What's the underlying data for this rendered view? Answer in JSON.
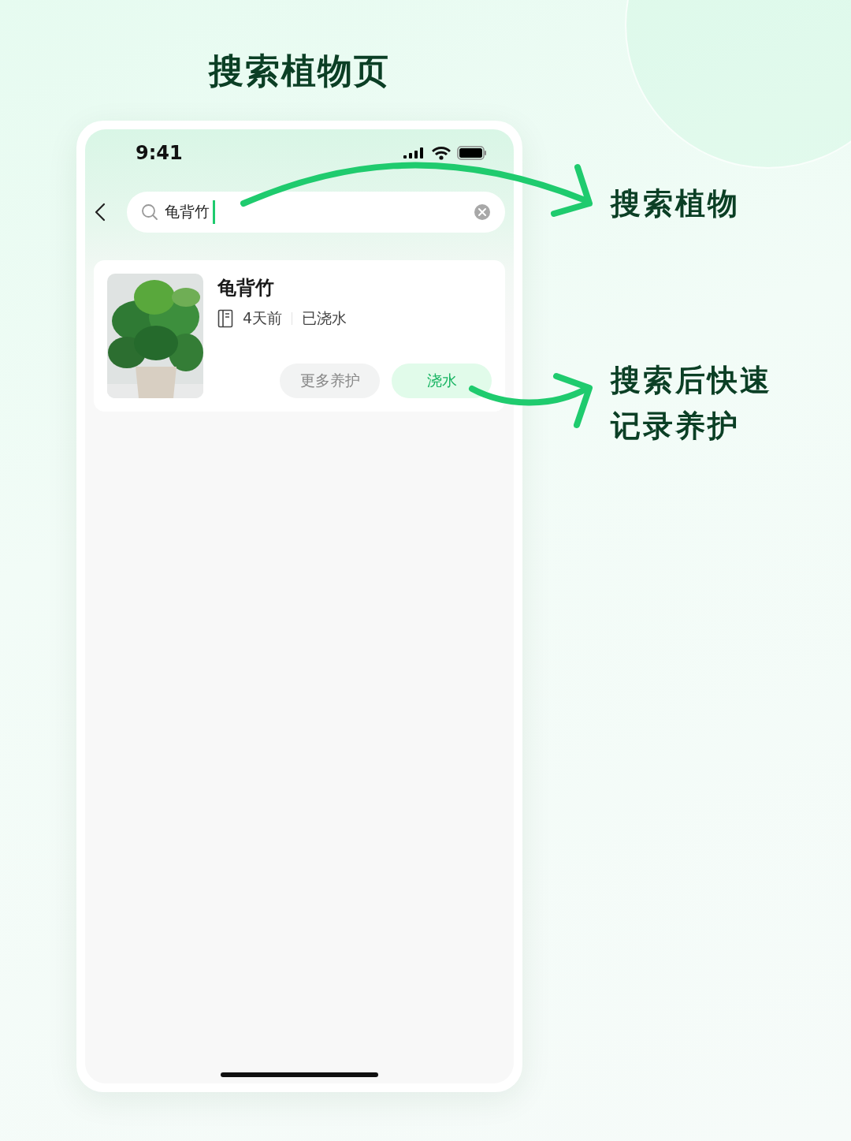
{
  "page_title": "搜索植物页",
  "phone": {
    "status_bar": {
      "time": "9:41"
    },
    "search": {
      "value": "龟背竹"
    },
    "results": [
      {
        "name": "龟背竹",
        "last_care": "4天前",
        "care_status": "已浇水",
        "buttons": [
          {
            "label": "更多养护",
            "kind": "secondary"
          },
          {
            "label": "浇水",
            "kind": "primary"
          }
        ]
      }
    ]
  },
  "annotations": [
    {
      "text": "搜索植物"
    },
    {
      "text": "搜索后快速记录养护"
    }
  ]
}
